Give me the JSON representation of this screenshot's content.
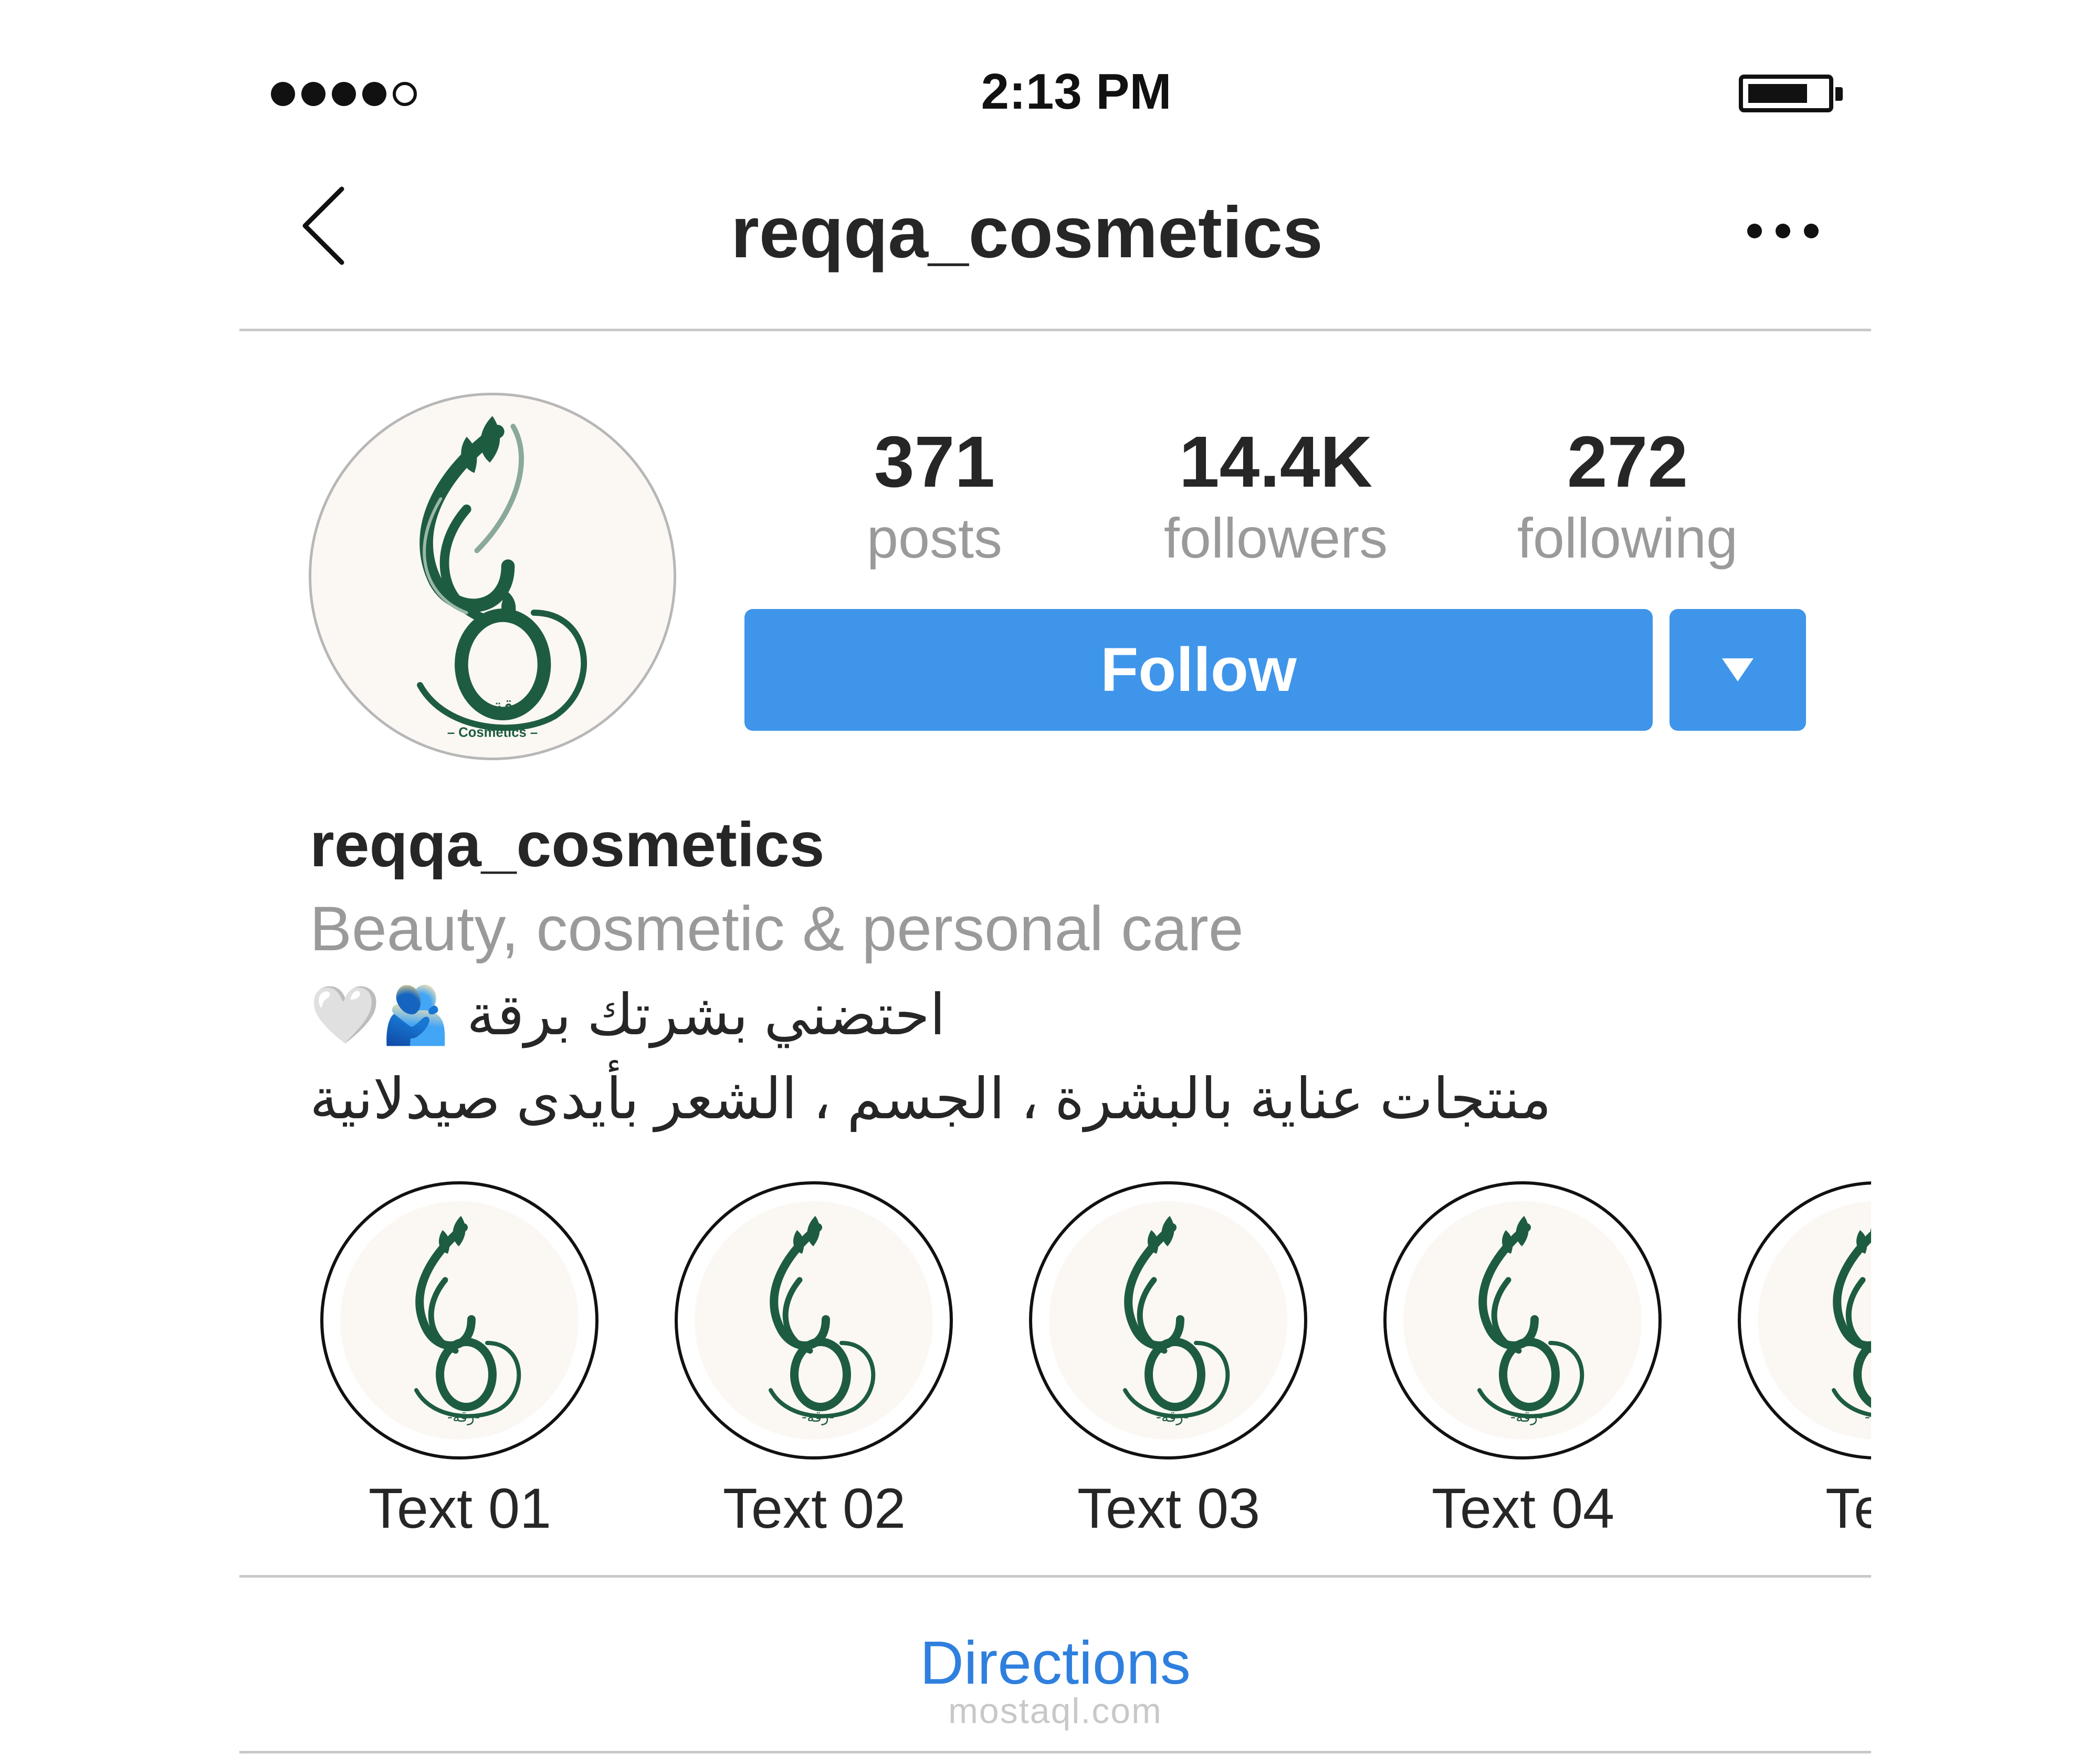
{
  "status_bar": {
    "time": "2:13 PM",
    "signal_bars_filled": 4,
    "signal_bars_total": 5,
    "battery_level": 0.7
  },
  "nav": {
    "title": "reqqa_cosmetics",
    "back_icon": "chevron-left-icon",
    "more_icon": "ellipsis-icon"
  },
  "profile": {
    "avatar_logo_text": "رقة",
    "avatar_logo_subtext": "– Cosmetics –",
    "stats": [
      {
        "value": "371",
        "label": "posts"
      },
      {
        "value": "14.4K",
        "label": "followers"
      },
      {
        "value": "272",
        "label": "following"
      }
    ],
    "follow_label": "Follow",
    "dropdown_icon": "caret-down-icon"
  },
  "bio": {
    "username": "reqqa_cosmetics",
    "category": "Beauty, cosmetic & personal care",
    "line1": "احتضني بشرتك برقة 🫂🤍",
    "line2": "منتجات عناية بالبشرة ، الجسم ، الشعر بأيدى صيدلانية"
  },
  "highlights": [
    {
      "label": "Text 01",
      "logo_text": "-رقة-"
    },
    {
      "label": "Text 02",
      "logo_text": "-رقة-"
    },
    {
      "label": "Text 03",
      "logo_text": "-رقة-"
    },
    {
      "label": "Text 04",
      "logo_text": "-رقة-"
    },
    {
      "label": "Text",
      "logo_text": "-رقة-"
    }
  ],
  "directions": {
    "label": "Directions"
  },
  "watermark": {
    "text": "mostaql.com"
  },
  "colors": {
    "follow_blue": "#3f95ea",
    "link_blue": "#2f7fde",
    "brand_green": "#1e5c40",
    "muted_gray": "#9a9a9a"
  }
}
